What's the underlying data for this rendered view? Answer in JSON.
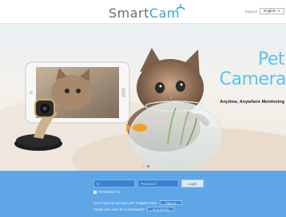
{
  "header": {
    "logo_part1": "Smart",
    "logo_part2": "Cam",
    "language_label": "Support",
    "language_value": "English"
  },
  "hero": {
    "title_line1": "Pet",
    "title_line2": "Camera",
    "subtitle": "Anytime, Anywhere Monitoring",
    "slide_count": 2,
    "active_slide": 2
  },
  "login": {
    "id_placeholder": "ID",
    "password_placeholder": "Password",
    "login_button": "Login",
    "remember_label": "Remember me",
    "signup_prompt": "Don't have an account yet? Register here.",
    "signup_button": "Sign up",
    "forgot_prompt": "Forgot your user ID or password?",
    "forgot_button": "Find ID/PW"
  },
  "colors": {
    "accent": "#5cc2ef",
    "login_bg": "#5fa6e6",
    "input_bg": "#3a83d2"
  }
}
